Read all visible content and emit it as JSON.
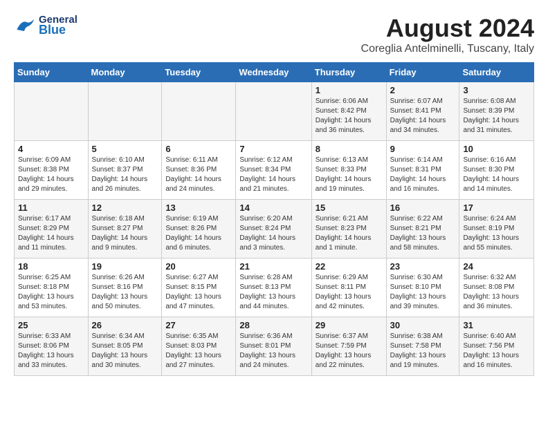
{
  "header": {
    "logo_general": "General",
    "logo_blue": "Blue",
    "title": "August 2024",
    "location": "Coreglia Antelminelli, Tuscany, Italy"
  },
  "days_of_week": [
    "Sunday",
    "Monday",
    "Tuesday",
    "Wednesday",
    "Thursday",
    "Friday",
    "Saturday"
  ],
  "weeks": [
    [
      {
        "day": "",
        "info": ""
      },
      {
        "day": "",
        "info": ""
      },
      {
        "day": "",
        "info": ""
      },
      {
        "day": "",
        "info": ""
      },
      {
        "day": "1",
        "info": "Sunrise: 6:06 AM\nSunset: 8:42 PM\nDaylight: 14 hours and 36 minutes."
      },
      {
        "day": "2",
        "info": "Sunrise: 6:07 AM\nSunset: 8:41 PM\nDaylight: 14 hours and 34 minutes."
      },
      {
        "day": "3",
        "info": "Sunrise: 6:08 AM\nSunset: 8:39 PM\nDaylight: 14 hours and 31 minutes."
      }
    ],
    [
      {
        "day": "4",
        "info": "Sunrise: 6:09 AM\nSunset: 8:38 PM\nDaylight: 14 hours and 29 minutes."
      },
      {
        "day": "5",
        "info": "Sunrise: 6:10 AM\nSunset: 8:37 PM\nDaylight: 14 hours and 26 minutes."
      },
      {
        "day": "6",
        "info": "Sunrise: 6:11 AM\nSunset: 8:36 PM\nDaylight: 14 hours and 24 minutes."
      },
      {
        "day": "7",
        "info": "Sunrise: 6:12 AM\nSunset: 8:34 PM\nDaylight: 14 hours and 21 minutes."
      },
      {
        "day": "8",
        "info": "Sunrise: 6:13 AM\nSunset: 8:33 PM\nDaylight: 14 hours and 19 minutes."
      },
      {
        "day": "9",
        "info": "Sunrise: 6:14 AM\nSunset: 8:31 PM\nDaylight: 14 hours and 16 minutes."
      },
      {
        "day": "10",
        "info": "Sunrise: 6:16 AM\nSunset: 8:30 PM\nDaylight: 14 hours and 14 minutes."
      }
    ],
    [
      {
        "day": "11",
        "info": "Sunrise: 6:17 AM\nSunset: 8:29 PM\nDaylight: 14 hours and 11 minutes."
      },
      {
        "day": "12",
        "info": "Sunrise: 6:18 AM\nSunset: 8:27 PM\nDaylight: 14 hours and 9 minutes."
      },
      {
        "day": "13",
        "info": "Sunrise: 6:19 AM\nSunset: 8:26 PM\nDaylight: 14 hours and 6 minutes."
      },
      {
        "day": "14",
        "info": "Sunrise: 6:20 AM\nSunset: 8:24 PM\nDaylight: 14 hours and 3 minutes."
      },
      {
        "day": "15",
        "info": "Sunrise: 6:21 AM\nSunset: 8:23 PM\nDaylight: 14 hours and 1 minute."
      },
      {
        "day": "16",
        "info": "Sunrise: 6:22 AM\nSunset: 8:21 PM\nDaylight: 13 hours and 58 minutes."
      },
      {
        "day": "17",
        "info": "Sunrise: 6:24 AM\nSunset: 8:19 PM\nDaylight: 13 hours and 55 minutes."
      }
    ],
    [
      {
        "day": "18",
        "info": "Sunrise: 6:25 AM\nSunset: 8:18 PM\nDaylight: 13 hours and 53 minutes."
      },
      {
        "day": "19",
        "info": "Sunrise: 6:26 AM\nSunset: 8:16 PM\nDaylight: 13 hours and 50 minutes."
      },
      {
        "day": "20",
        "info": "Sunrise: 6:27 AM\nSunset: 8:15 PM\nDaylight: 13 hours and 47 minutes."
      },
      {
        "day": "21",
        "info": "Sunrise: 6:28 AM\nSunset: 8:13 PM\nDaylight: 13 hours and 44 minutes."
      },
      {
        "day": "22",
        "info": "Sunrise: 6:29 AM\nSunset: 8:11 PM\nDaylight: 13 hours and 42 minutes."
      },
      {
        "day": "23",
        "info": "Sunrise: 6:30 AM\nSunset: 8:10 PM\nDaylight: 13 hours and 39 minutes."
      },
      {
        "day": "24",
        "info": "Sunrise: 6:32 AM\nSunset: 8:08 PM\nDaylight: 13 hours and 36 minutes."
      }
    ],
    [
      {
        "day": "25",
        "info": "Sunrise: 6:33 AM\nSunset: 8:06 PM\nDaylight: 13 hours and 33 minutes."
      },
      {
        "day": "26",
        "info": "Sunrise: 6:34 AM\nSunset: 8:05 PM\nDaylight: 13 hours and 30 minutes."
      },
      {
        "day": "27",
        "info": "Sunrise: 6:35 AM\nSunset: 8:03 PM\nDaylight: 13 hours and 27 minutes."
      },
      {
        "day": "28",
        "info": "Sunrise: 6:36 AM\nSunset: 8:01 PM\nDaylight: 13 hours and 24 minutes."
      },
      {
        "day": "29",
        "info": "Sunrise: 6:37 AM\nSunset: 7:59 PM\nDaylight: 13 hours and 22 minutes."
      },
      {
        "day": "30",
        "info": "Sunrise: 6:38 AM\nSunset: 7:58 PM\nDaylight: 13 hours and 19 minutes."
      },
      {
        "day": "31",
        "info": "Sunrise: 6:40 AM\nSunset: 7:56 PM\nDaylight: 13 hours and 16 minutes."
      }
    ]
  ]
}
